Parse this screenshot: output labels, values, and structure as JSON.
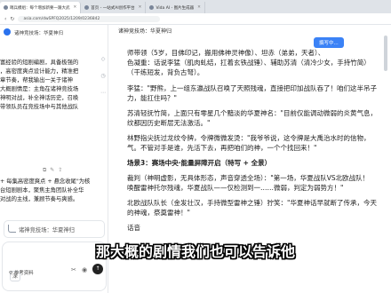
{
  "browser": {
    "tabs": [
      {
        "label": "哨兵模组：每个增加新要一跟大武"
      },
      {
        "label": "首页 - 一站式AI创作平台"
      },
      {
        "label": "Vida AI - 图片生成器"
      }
    ],
    "url": "asia.com/dwSPFQ2025/1209/0236842"
  },
  "chat": {
    "title": "诸神竞技场：华夏神归",
    "left_lines": [
      "富经验的短剧编剧，具备极强的",
      "，高密度爽点设计能力，精准把",
      "章节奏，帮我输出一关于诸神",
      "大概剧情是：主角在诸神竞技场",
      "神明对战，补全神话历史，召唤",
      "带领队员在竞技场中与其他战队",
      "+ 每集高密度爽点 + 悬念收尾\"为核",
      "台短剧剧本，聚焦主角团队补全华",
      "对战的主线，兼顾节奏与爽感。"
    ],
    "ref_card": "诸神竞技场：华夏神归",
    "input_placeholder": "",
    "ref_docs": "参考资料",
    "deep_think": "深"
  },
  "doc": {
    "header": "诸神竞技场：华夏神归",
    "expand_button": "撰写中...",
    "lines": [
      {
        "text": "师带领（5岁，目佛印记，搬用佛神灵神像）、坦赤（弟弟，天者）、",
        "bold": false
      },
      {
        "text": "色凝重：话说李猛（肌肉虬结，扛着玄铁战锤）、辅助苏清（清冷少女，手持竹简）",
        "bold": false
      },
      {
        "text": "（干练短发，背负古弩）。",
        "bold": false
      },
      {
        "text": "李猛：\"野熊，上一组东瀛战队召唤了天照残魂，直接把印加战队吞了！咱们这半吊子",
        "bold": false
      },
      {
        "text": "力，能扛住吗？\"",
        "bold": false
      },
      {
        "text": "苏清轻抚竹简，上面只有零星几个黯淡的华夏神名：\"目前仅能调动微弱的炎黄气息，",
        "bold": false
      },
      {
        "text": "纹都因历史断层无法激活。\"",
        "bold": false
      },
      {
        "text": "林野指尖抚过龙纹令牌，令牌微微发烫：\"我爷爷说，这令牌是大禹治水时的信物，",
        "bold": false
      },
      {
        "text": "气。不管对手是谁，先活下去，再把咱们的神，一个个找回来！\"",
        "bold": false
      },
      {
        "text": "场景3：赛场中央·能量屏障开启（特写 + 全景）",
        "bold": true
      },
      {
        "text": "裁判（神明虚影，无具体形态，声音穿透全场）：\"第一场，华夏战队VS北欧战队！",
        "bold": false
      },
      {
        "text": "唤醒雷神托尔残魂，华夏战队——仅检测到一……微弱，判定为弱势方！\"",
        "bold": false
      },
      {
        "text": "北欧战队队长（金发壮汉，手持微型雷神之锤）狞笑：\"华夏神话早就断了传承，今天",
        "bold": false
      },
      {
        "text": "的神魂，祭奠雷神！\"",
        "bold": false
      },
      {
        "text": "话音",
        "bold": false
      }
    ]
  },
  "subtitle": "那大概的剧情我们也可以告诉他"
}
